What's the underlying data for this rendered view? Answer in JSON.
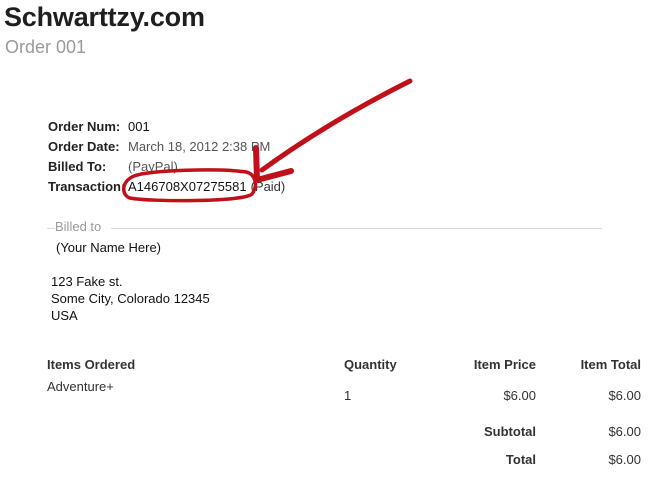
{
  "header": {
    "site_title": "Schwarttzy.com",
    "order_title": "Order 001"
  },
  "order_info": {
    "order_num_label": "Order Num:",
    "order_num_value": "001",
    "order_date_label": "Order Date:",
    "order_date_value": "March 18, 2012 2:38 PM",
    "billed_to_label": "Billed To:",
    "billed_to_value": "(PayPal)",
    "transaction_label": "Transaction:",
    "transaction_id": "A146708X07275581",
    "transaction_status": "(Paid)"
  },
  "billing": {
    "legend": "Billed to",
    "name": "(Your Name Here)",
    "address_line1": "123 Fake st.",
    "address_line2": "Some City, Colorado 12345",
    "address_line3": "USA"
  },
  "items": {
    "headers": {
      "item": "Items Ordered",
      "quantity": "Quantity",
      "price": "Item Price",
      "total": "Item Total"
    },
    "rows": [
      {
        "name": "Adventure+",
        "quantity": "1",
        "price": "$6.00",
        "total": "$6.00"
      }
    ],
    "subtotal_label": "Subtotal",
    "subtotal_value": "$6.00",
    "total_label": "Total",
    "total_value": "$6.00"
  },
  "colors": {
    "annotation": "#c0101a"
  }
}
